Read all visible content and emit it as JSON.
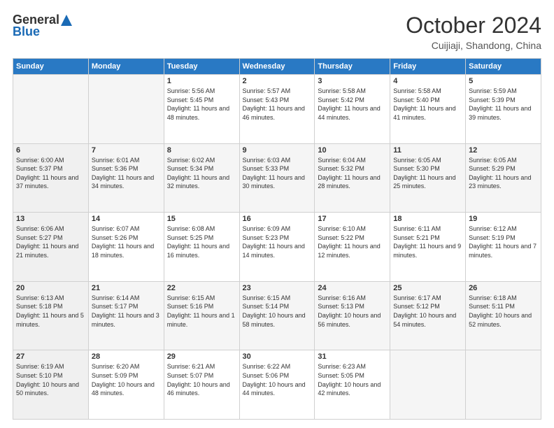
{
  "header": {
    "logo_general": "General",
    "logo_blue": "Blue",
    "title": "October 2024",
    "location": "Cuijiaji, Shandong, China"
  },
  "weekdays": [
    "Sunday",
    "Monday",
    "Tuesday",
    "Wednesday",
    "Thursday",
    "Friday",
    "Saturday"
  ],
  "weeks": [
    [
      {
        "day": "",
        "info": ""
      },
      {
        "day": "",
        "info": ""
      },
      {
        "day": "1",
        "info": "Sunrise: 5:56 AM\nSunset: 5:45 PM\nDaylight: 11 hours and 48 minutes."
      },
      {
        "day": "2",
        "info": "Sunrise: 5:57 AM\nSunset: 5:43 PM\nDaylight: 11 hours and 46 minutes."
      },
      {
        "day": "3",
        "info": "Sunrise: 5:58 AM\nSunset: 5:42 PM\nDaylight: 11 hours and 44 minutes."
      },
      {
        "day": "4",
        "info": "Sunrise: 5:58 AM\nSunset: 5:40 PM\nDaylight: 11 hours and 41 minutes."
      },
      {
        "day": "5",
        "info": "Sunrise: 5:59 AM\nSunset: 5:39 PM\nDaylight: 11 hours and 39 minutes."
      }
    ],
    [
      {
        "day": "6",
        "info": "Sunrise: 6:00 AM\nSunset: 5:37 PM\nDaylight: 11 hours and 37 minutes."
      },
      {
        "day": "7",
        "info": "Sunrise: 6:01 AM\nSunset: 5:36 PM\nDaylight: 11 hours and 34 minutes."
      },
      {
        "day": "8",
        "info": "Sunrise: 6:02 AM\nSunset: 5:34 PM\nDaylight: 11 hours and 32 minutes."
      },
      {
        "day": "9",
        "info": "Sunrise: 6:03 AM\nSunset: 5:33 PM\nDaylight: 11 hours and 30 minutes."
      },
      {
        "day": "10",
        "info": "Sunrise: 6:04 AM\nSunset: 5:32 PM\nDaylight: 11 hours and 28 minutes."
      },
      {
        "day": "11",
        "info": "Sunrise: 6:05 AM\nSunset: 5:30 PM\nDaylight: 11 hours and 25 minutes."
      },
      {
        "day": "12",
        "info": "Sunrise: 6:05 AM\nSunset: 5:29 PM\nDaylight: 11 hours and 23 minutes."
      }
    ],
    [
      {
        "day": "13",
        "info": "Sunrise: 6:06 AM\nSunset: 5:27 PM\nDaylight: 11 hours and 21 minutes."
      },
      {
        "day": "14",
        "info": "Sunrise: 6:07 AM\nSunset: 5:26 PM\nDaylight: 11 hours and 18 minutes."
      },
      {
        "day": "15",
        "info": "Sunrise: 6:08 AM\nSunset: 5:25 PM\nDaylight: 11 hours and 16 minutes."
      },
      {
        "day": "16",
        "info": "Sunrise: 6:09 AM\nSunset: 5:23 PM\nDaylight: 11 hours and 14 minutes."
      },
      {
        "day": "17",
        "info": "Sunrise: 6:10 AM\nSunset: 5:22 PM\nDaylight: 11 hours and 12 minutes."
      },
      {
        "day": "18",
        "info": "Sunrise: 6:11 AM\nSunset: 5:21 PM\nDaylight: 11 hours and 9 minutes."
      },
      {
        "day": "19",
        "info": "Sunrise: 6:12 AM\nSunset: 5:19 PM\nDaylight: 11 hours and 7 minutes."
      }
    ],
    [
      {
        "day": "20",
        "info": "Sunrise: 6:13 AM\nSunset: 5:18 PM\nDaylight: 11 hours and 5 minutes."
      },
      {
        "day": "21",
        "info": "Sunrise: 6:14 AM\nSunset: 5:17 PM\nDaylight: 11 hours and 3 minutes."
      },
      {
        "day": "22",
        "info": "Sunrise: 6:15 AM\nSunset: 5:16 PM\nDaylight: 11 hours and 1 minute."
      },
      {
        "day": "23",
        "info": "Sunrise: 6:15 AM\nSunset: 5:14 PM\nDaylight: 10 hours and 58 minutes."
      },
      {
        "day": "24",
        "info": "Sunrise: 6:16 AM\nSunset: 5:13 PM\nDaylight: 10 hours and 56 minutes."
      },
      {
        "day": "25",
        "info": "Sunrise: 6:17 AM\nSunset: 5:12 PM\nDaylight: 10 hours and 54 minutes."
      },
      {
        "day": "26",
        "info": "Sunrise: 6:18 AM\nSunset: 5:11 PM\nDaylight: 10 hours and 52 minutes."
      }
    ],
    [
      {
        "day": "27",
        "info": "Sunrise: 6:19 AM\nSunset: 5:10 PM\nDaylight: 10 hours and 50 minutes."
      },
      {
        "day": "28",
        "info": "Sunrise: 6:20 AM\nSunset: 5:09 PM\nDaylight: 10 hours and 48 minutes."
      },
      {
        "day": "29",
        "info": "Sunrise: 6:21 AM\nSunset: 5:07 PM\nDaylight: 10 hours and 46 minutes."
      },
      {
        "day": "30",
        "info": "Sunrise: 6:22 AM\nSunset: 5:06 PM\nDaylight: 10 hours and 44 minutes."
      },
      {
        "day": "31",
        "info": "Sunrise: 6:23 AM\nSunset: 5:05 PM\nDaylight: 10 hours and 42 minutes."
      },
      {
        "day": "",
        "info": ""
      },
      {
        "day": "",
        "info": ""
      }
    ]
  ]
}
